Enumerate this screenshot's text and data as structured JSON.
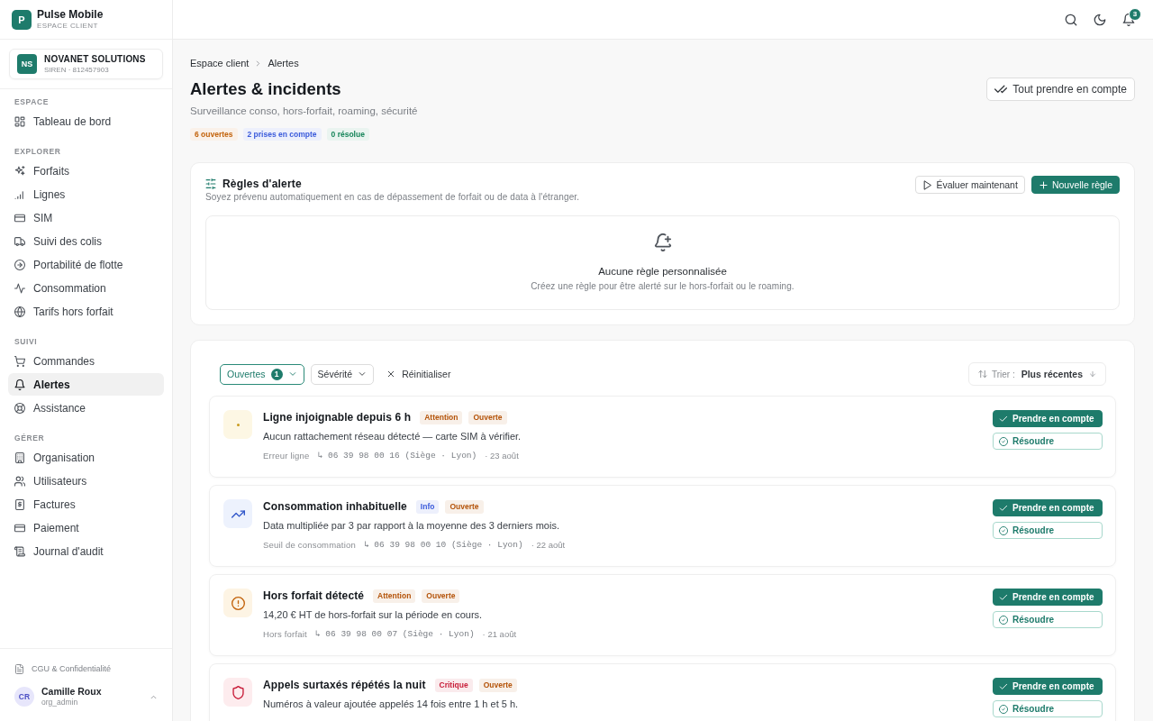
{
  "brand": {
    "logo": "P",
    "name": "Pulse Mobile",
    "tagline": "ESPACE CLIENT"
  },
  "organization": {
    "initials": "NS",
    "name": "NOVANET SOLUTIONS",
    "siren": "SIREN · 812457903"
  },
  "sidebar": {
    "sections": [
      {
        "title": "ESPACE",
        "items": [
          {
            "label": "Tableau de bord",
            "selected": false
          }
        ]
      },
      {
        "title": "EXPLORER",
        "items": [
          {
            "label": "Forfaits",
            "selected": false
          },
          {
            "label": "Lignes",
            "selected": false
          },
          {
            "label": "SIM",
            "selected": false
          },
          {
            "label": "Suivi des colis",
            "selected": false
          },
          {
            "label": "Portabilité de flotte",
            "selected": false
          },
          {
            "label": "Consommation",
            "selected": false
          },
          {
            "label": "Tarifs hors forfait",
            "selected": false
          }
        ]
      },
      {
        "title": "SUIVI",
        "items": [
          {
            "label": "Commandes",
            "selected": false
          },
          {
            "label": "Alertes",
            "selected": true
          },
          {
            "label": "Assistance",
            "selected": false
          }
        ]
      },
      {
        "title": "GÉRER",
        "items": [
          {
            "label": "Organisation",
            "selected": false
          },
          {
            "label": "Utilisateurs",
            "selected": false
          },
          {
            "label": "Factures",
            "selected": false
          },
          {
            "label": "Paiement",
            "selected": false
          },
          {
            "label": "Journal d'audit",
            "selected": false
          }
        ]
      }
    ],
    "footer_link": "CGU & Confidentialité",
    "user": {
      "initials": "CR",
      "name": "Camille Roux",
      "role": "org_admin"
    }
  },
  "topbar": {
    "notification_count": "3"
  },
  "breadcrumb": [
    "Espace client",
    "Alertes"
  ],
  "page": {
    "title": "Alertes & incidents",
    "subtitle": "Surveillance conso, hors-forfait, roaming, sécurité",
    "action": "Tout prendre en compte",
    "stats": [
      {
        "label": "6 ouvertes",
        "color": "#c2620a"
      },
      {
        "label": "2 prises en compte",
        "color": "#3b5bdb"
      },
      {
        "label": "0 résolue",
        "color": "#16855a"
      }
    ]
  },
  "rules": {
    "title": "Règles d'alerte",
    "subtitle": "Soyez prévenu automatiquement en cas de dépassement de forfait ou de data à l'étranger.",
    "buttons": [
      {
        "label": "Évaluer maintenant",
        "kind": "secondary"
      },
      {
        "label": "Nouvelle règle",
        "kind": "primary"
      }
    ],
    "empty": {
      "title": "Aucune règle personnalisée",
      "text": "Créez une règle pour être alerté sur le hors-forfait ou le roaming."
    }
  },
  "alerts": {
    "filters": [
      {
        "label": "Ouvertes",
        "count": "1",
        "selected": true
      },
      {
        "label": "Sévérité",
        "selected": false
      }
    ],
    "reset": "Réinitialiser",
    "sort": {
      "label": "Trier :",
      "value": "Plus récentes"
    },
    "items": [
      {
        "kind": "unreachable",
        "title": "Ligne injoignable depuis 6 h",
        "severity": {
          "label": "Attention",
          "color": "#b45309"
        },
        "status": {
          "label": "Ouverte",
          "color": "#b45309"
        },
        "description": "Aucun rattachement réseau détecté — carte SIM à vérifier.",
        "meta": {
          "type": "Erreur ligne",
          "line": "↳ 06 39 98 00 16 (Siège · Lyon)",
          "date": "· 23 août"
        },
        "actions": [
          {
            "label": "Prendre en compte",
            "kind": "primary"
          },
          {
            "label": "Résoudre",
            "kind": "secondary"
          }
        ]
      },
      {
        "kind": "usage",
        "title": "Consommation inhabituelle",
        "severity": {
          "label": "Info",
          "color": "#3b5bdb"
        },
        "status": {
          "label": "Ouverte",
          "color": "#b45309"
        },
        "description": "Data multipliée par 3 par rapport à la moyenne des 3 derniers mois.",
        "meta": {
          "type": "Seuil de consommation",
          "line": "↳ 06 39 98 00 10 (Siège · Lyon)",
          "date": "· 22 août"
        },
        "actions": [
          {
            "label": "Prendre en compte",
            "kind": "primary"
          },
          {
            "label": "Résoudre",
            "kind": "secondary"
          }
        ]
      },
      {
        "kind": "overage",
        "title": "Hors forfait détecté",
        "severity": {
          "label": "Attention",
          "color": "#b45309"
        },
        "status": {
          "label": "Ouverte",
          "color": "#b45309"
        },
        "description": "14,20 € HT de hors-forfait sur la période en cours.",
        "meta": {
          "type": "Hors forfait",
          "line": "↳ 06 39 98 00 07 (Siège · Lyon)",
          "date": "· 21 août"
        },
        "actions": [
          {
            "label": "Prendre en compte",
            "kind": "primary"
          },
          {
            "label": "Résoudre",
            "kind": "secondary"
          }
        ]
      },
      {
        "kind": "fraud",
        "title": "Appels surtaxés répétés la nuit",
        "severity": {
          "label": "Critique",
          "color": "#c81e3a"
        },
        "status": {
          "label": "Ouverte",
          "color": "#b45309"
        },
        "description": "Numéros à valeur ajoutée appelés 14 fois entre 1 h et 5 h.",
        "actions": [
          {
            "label": "Prendre en compte",
            "kind": "primary"
          },
          {
            "label": "Résoudre",
            "kind": "secondary"
          }
        ]
      }
    ]
  }
}
